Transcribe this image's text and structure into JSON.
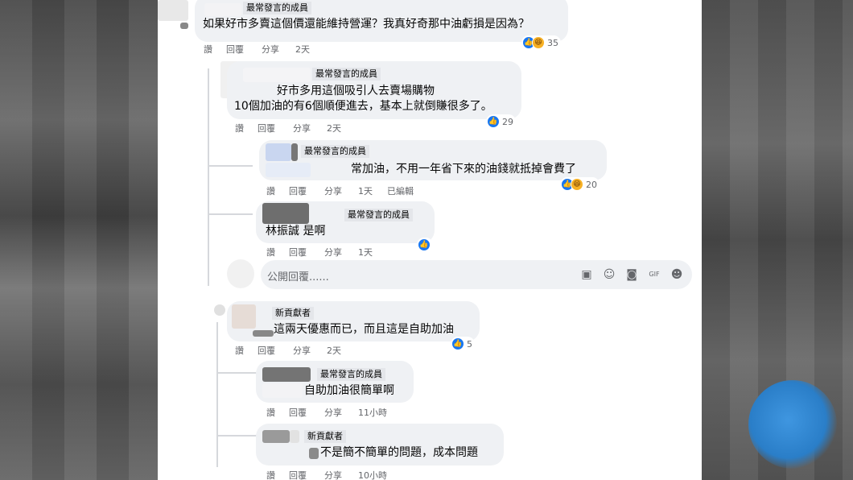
{
  "comments": [
    {
      "badge": "最常發言的成員",
      "text": "如果好市多賣這個價還能維持營運？我真好奇那中油虧損是因為？",
      "actions": [
        "讚",
        "回覆",
        "分享",
        "2天"
      ],
      "reactions": {
        "types": [
          "like",
          "haha"
        ],
        "count": "35"
      }
    },
    {
      "badge": "最常發言的成員",
      "text_line1": "好市多用這個吸引人去賣場購物",
      "text_line2": "10個加油的有6個順便進去，基本上就倒賺很多了。",
      "actions": [
        "讚",
        "回覆",
        "分享",
        "2天"
      ],
      "reactions": {
        "types": [
          "like"
        ],
        "count": "29"
      }
    },
    {
      "badge": "最常發言的成員",
      "text": "常加油，不用一年省下來的油錢就抵掉會費了",
      "actions": [
        "讚",
        "回覆",
        "分享",
        "1天",
        "已編輯"
      ],
      "reactions": {
        "types": [
          "like",
          "haha"
        ],
        "count": "20"
      }
    },
    {
      "badge": "最常發言的成員",
      "mention": "林振誠",
      "text": "是啊",
      "actions": [
        "讚",
        "回覆",
        "分享",
        "1天"
      ],
      "reactions": {
        "types": [
          "like"
        ],
        "count": ""
      }
    },
    {
      "badge": "新貢獻者",
      "text": "這兩天優惠而已，而且這是自助加油",
      "actions": [
        "讚",
        "回覆",
        "分享",
        "2天"
      ],
      "reactions": {
        "types": [
          "like"
        ],
        "count": "5"
      }
    },
    {
      "badge": "最常發言的成員",
      "text": "自助加油很簡單啊",
      "actions": [
        "讚",
        "回覆",
        "分享",
        "11小時"
      ]
    },
    {
      "badge": "新貢獻者",
      "text": "不是簡不簡單的問題，成本問題",
      "actions": [
        "讚",
        "回覆",
        "分享",
        "10小時"
      ]
    }
  ],
  "reply_input": {
    "placeholder": "公開回覆......"
  },
  "reply_tools": [
    "sticker-icon",
    "emoji-icon",
    "camera-icon",
    "gif-icon",
    "avatar-sticker-icon"
  ],
  "colors": {
    "bubble": "#eff1f4",
    "like": "#1877f2",
    "haha": "#f7b125",
    "meta": "#65676b"
  }
}
